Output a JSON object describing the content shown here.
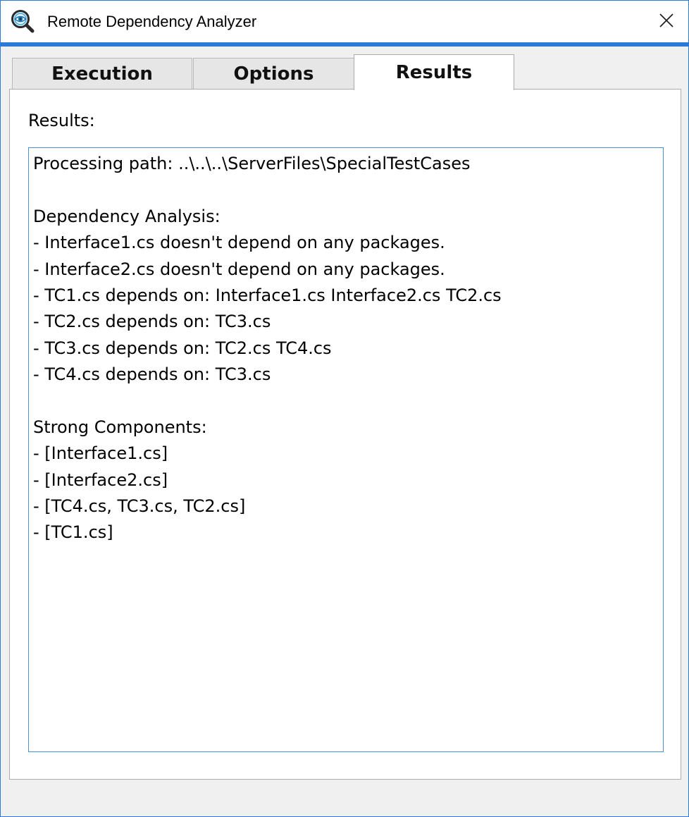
{
  "window": {
    "title": "Remote Dependency Analyzer",
    "accent_color": "#2b7ad8",
    "app_icon": "magnifier-eye-icon",
    "close_icon": "close-icon"
  },
  "tabs": [
    {
      "label": "Execution",
      "active": false
    },
    {
      "label": "Options",
      "active": false
    },
    {
      "label": "Results",
      "active": true
    }
  ],
  "results": {
    "label": "Results:",
    "lines": [
      "Processing path: ..\\..\\..\\ServerFiles\\SpecialTestCases",
      "",
      "Dependency Analysis:",
      "- Interface1.cs doesn't depend on any packages.",
      "- Interface2.cs doesn't depend on any packages.",
      "- TC1.cs depends on: Interface1.cs Interface2.cs TC2.cs",
      "- TC2.cs depends on: TC3.cs",
      "- TC3.cs depends on: TC2.cs TC4.cs",
      "- TC4.cs depends on: TC3.cs",
      "",
      "Strong Components:",
      "- [Interface1.cs]",
      "- [Interface2.cs]",
      "- [TC4.cs, TC3.cs, TC2.cs]",
      "- [TC1.cs]"
    ]
  }
}
